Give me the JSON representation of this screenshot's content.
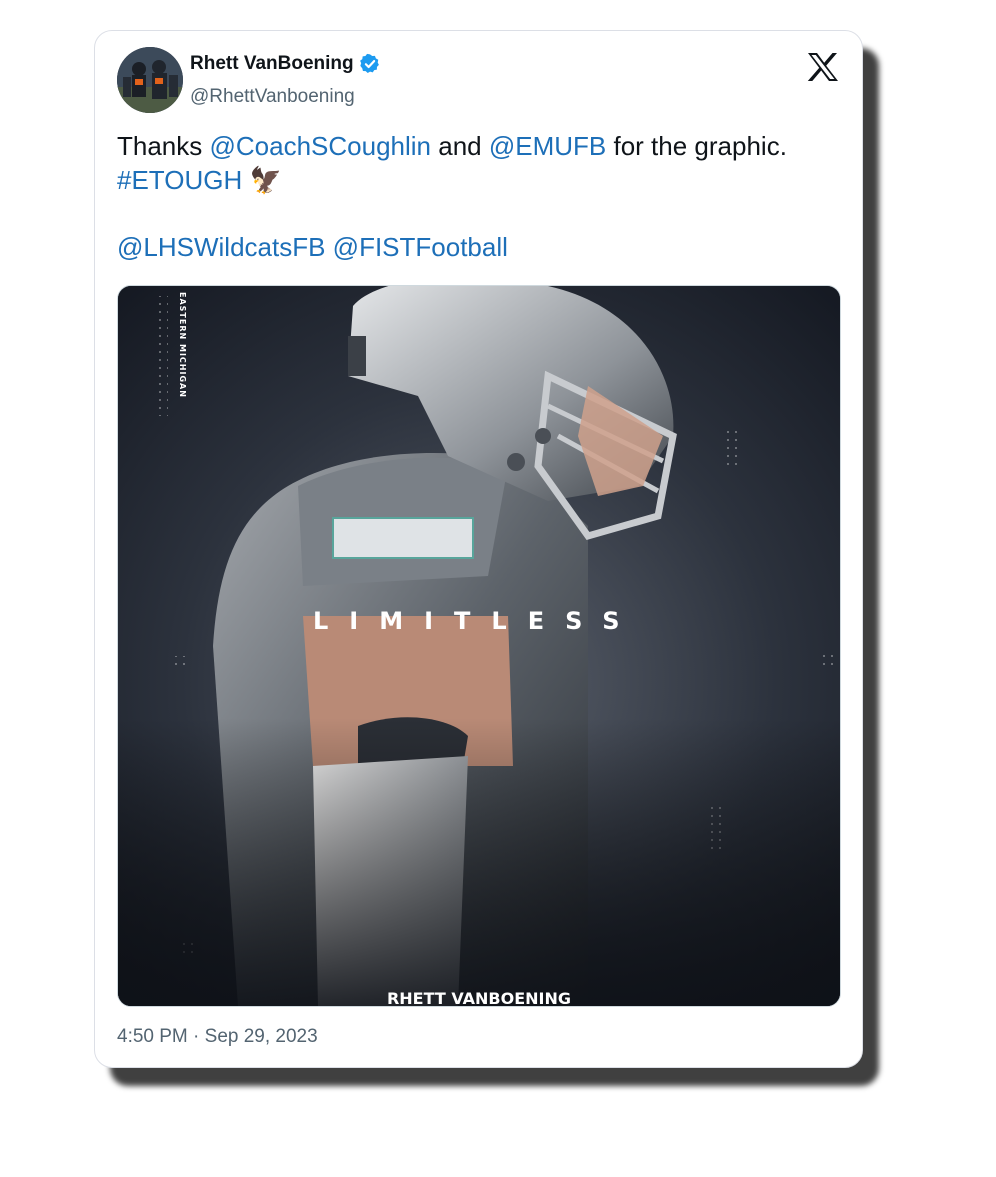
{
  "tweet": {
    "display_name": "Rhett VanBoening",
    "handle": "@RhettVanboening",
    "text": {
      "thanks": "Thanks ",
      "mention_1": "@CoachSCoughlin",
      "and": " and ",
      "mention_2": "@EMUFB",
      "for_graphic": " for the graphic.",
      "hashtag": "#ETOUGH",
      "emoji": "🦅",
      "mention_3": "@LHSWildcatsFB",
      "mention_4": "@FISTFootball"
    },
    "timestamp": "4:50 PM · Sep 29, 2023"
  },
  "media": {
    "headline": "LIMITLESS",
    "player_name": "RHETT VANBOENING",
    "side_text": "EASTERN MICHIGAN"
  },
  "colors": {
    "link": "#1d6fb8",
    "verified": "#1d9bf0",
    "text": "#0f1419",
    "muted": "#536471"
  },
  "icons": {
    "verified": "verified-badge-icon",
    "platform": "x-logo-icon"
  }
}
